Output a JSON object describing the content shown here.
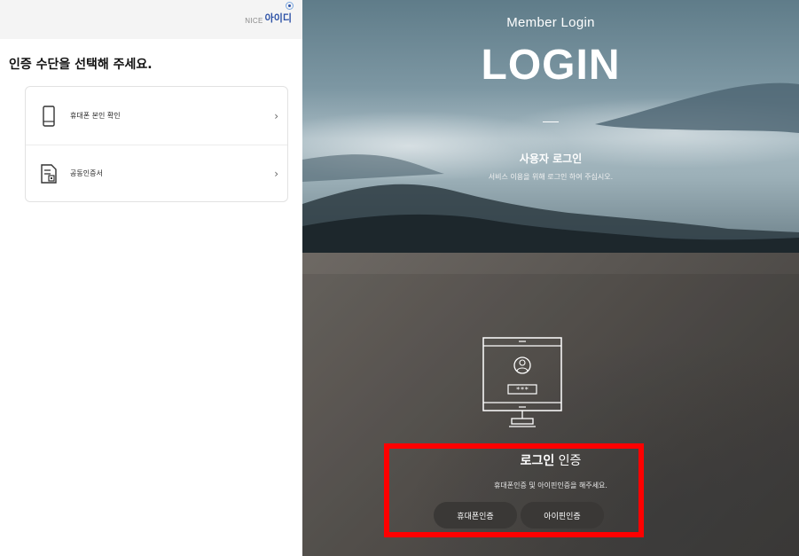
{
  "popup": {
    "brand_prefix": "NICE",
    "brand_name": "아이디",
    "title": "인증 수단을 선택해 주세요.",
    "methods": [
      {
        "label": "휴대폰 본인 확인",
        "icon": "mobile-phone-icon",
        "chevron": "›"
      },
      {
        "label": "공동인증서",
        "icon": "certificate-icon",
        "chevron": "›"
      }
    ]
  },
  "login": {
    "subtitle": "Member Login",
    "heading": "LOGIN",
    "section_title": "사용자 로그인",
    "section_desc": "서비스 이용을 위해 로그인 하여 주십시오.",
    "monitor_password": "***",
    "auth_title_bold": "로그인",
    "auth_title_rest": " 인증",
    "auth_desc": "휴대폰인증 및 아이핀인증을 해주세요.",
    "buttons": {
      "phone": "휴대폰인증",
      "ipin": "아이핀인증"
    }
  },
  "colors": {
    "highlight": "#ff0000",
    "button_bg": "#3a3836",
    "brand_blue": "#2a4fa5"
  }
}
